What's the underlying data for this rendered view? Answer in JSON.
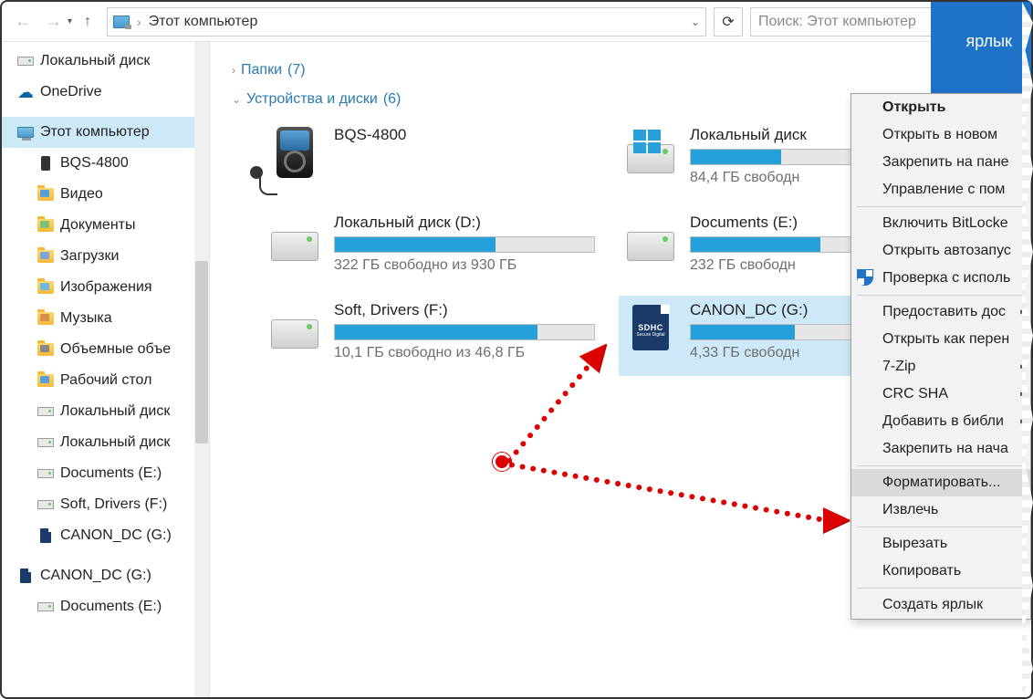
{
  "nav": {
    "location": "Этот компьютер",
    "search_placeholder": "Поиск: Этот компьютер"
  },
  "sidebar": {
    "items": [
      {
        "label": "Локальный диск",
        "icon": "drive"
      },
      {
        "label": "OneDrive",
        "icon": "onedrive"
      },
      {
        "label": "Этот компьютер",
        "icon": "pc",
        "selected": true
      },
      {
        "label": "BQS-4800",
        "icon": "phone",
        "indent": true
      },
      {
        "label": "Видео",
        "icon": "folder-video",
        "indent": true
      },
      {
        "label": "Документы",
        "icon": "folder-doc",
        "indent": true
      },
      {
        "label": "Загрузки",
        "icon": "folder-dl",
        "indent": true
      },
      {
        "label": "Изображения",
        "icon": "folder-img",
        "indent": true
      },
      {
        "label": "Музыка",
        "icon": "folder-music",
        "indent": true
      },
      {
        "label": "Объемные объе",
        "icon": "folder-obj",
        "indent": true
      },
      {
        "label": "Рабочий стол",
        "icon": "folder-desktop",
        "indent": true
      },
      {
        "label": "Локальный диск",
        "icon": "drive",
        "indent": true
      },
      {
        "label": "Локальный диск",
        "icon": "drive",
        "indent": true
      },
      {
        "label": "Documents (E:)",
        "icon": "drive",
        "indent": true
      },
      {
        "label": "Soft, Drivers (F:)",
        "icon": "drive",
        "indent": true
      },
      {
        "label": "CANON_DC (G:)",
        "icon": "sd",
        "indent": true
      },
      {
        "label": "CANON_DC (G:)",
        "icon": "sd"
      },
      {
        "label": "Documents (E:)",
        "icon": "drive",
        "indent": true
      }
    ]
  },
  "sections": {
    "folders": {
      "label": "Папки",
      "count": "(7)"
    },
    "devices": {
      "label": "Устройства и диски",
      "count": "(6)"
    }
  },
  "drives": [
    {
      "name": "BQS-4800",
      "type": "player",
      "fill": 0,
      "free": ""
    },
    {
      "name": "Локальный диск",
      "type": "windrive",
      "fill": 35,
      "free": "84,4 ГБ свободн"
    },
    {
      "name": "Локальный диск (D:)",
      "type": "drive",
      "fill": 62,
      "free": "322 ГБ свободно из 930 ГБ"
    },
    {
      "name": "Documents (E:)",
      "type": "drive",
      "fill": 50,
      "free": "232 ГБ свободн"
    },
    {
      "name": "Soft, Drivers (F:)",
      "type": "drive",
      "fill": 78,
      "free": "10,1 ГБ свободно из 46,8 ГБ"
    },
    {
      "name": "CANON_DC (G:)",
      "type": "sd",
      "fill": 40,
      "free": "4,33 ГБ свободн",
      "selected": true
    }
  ],
  "context_menu": {
    "title_badge": "ярлык",
    "items": [
      {
        "label": "Открыть",
        "bold": true
      },
      {
        "label": "Открыть в новом"
      },
      {
        "label": "Закрепить на пане"
      },
      {
        "label": "Управление с пом"
      },
      {
        "sep": true
      },
      {
        "label": "Включить BitLocke"
      },
      {
        "label": "Открыть автозапус"
      },
      {
        "label": "Проверка с исполь",
        "icon": "shield"
      },
      {
        "sep": true
      },
      {
        "label": "Предоставить дос",
        "sub": true
      },
      {
        "label": "Открыть как перен"
      },
      {
        "label": "7-Zip",
        "sub": true
      },
      {
        "label": "CRC SHA",
        "sub": true
      },
      {
        "label": "Добавить в библи",
        "sub": true
      },
      {
        "label": "Закрепить на нача"
      },
      {
        "sep": true
      },
      {
        "label": "Форматировать...",
        "highlighted": true
      },
      {
        "label": "Извлечь"
      },
      {
        "sep": true
      },
      {
        "label": "Вырезать"
      },
      {
        "label": "Копировать"
      },
      {
        "sep": true
      },
      {
        "label": "Создать ярлык"
      }
    ]
  }
}
